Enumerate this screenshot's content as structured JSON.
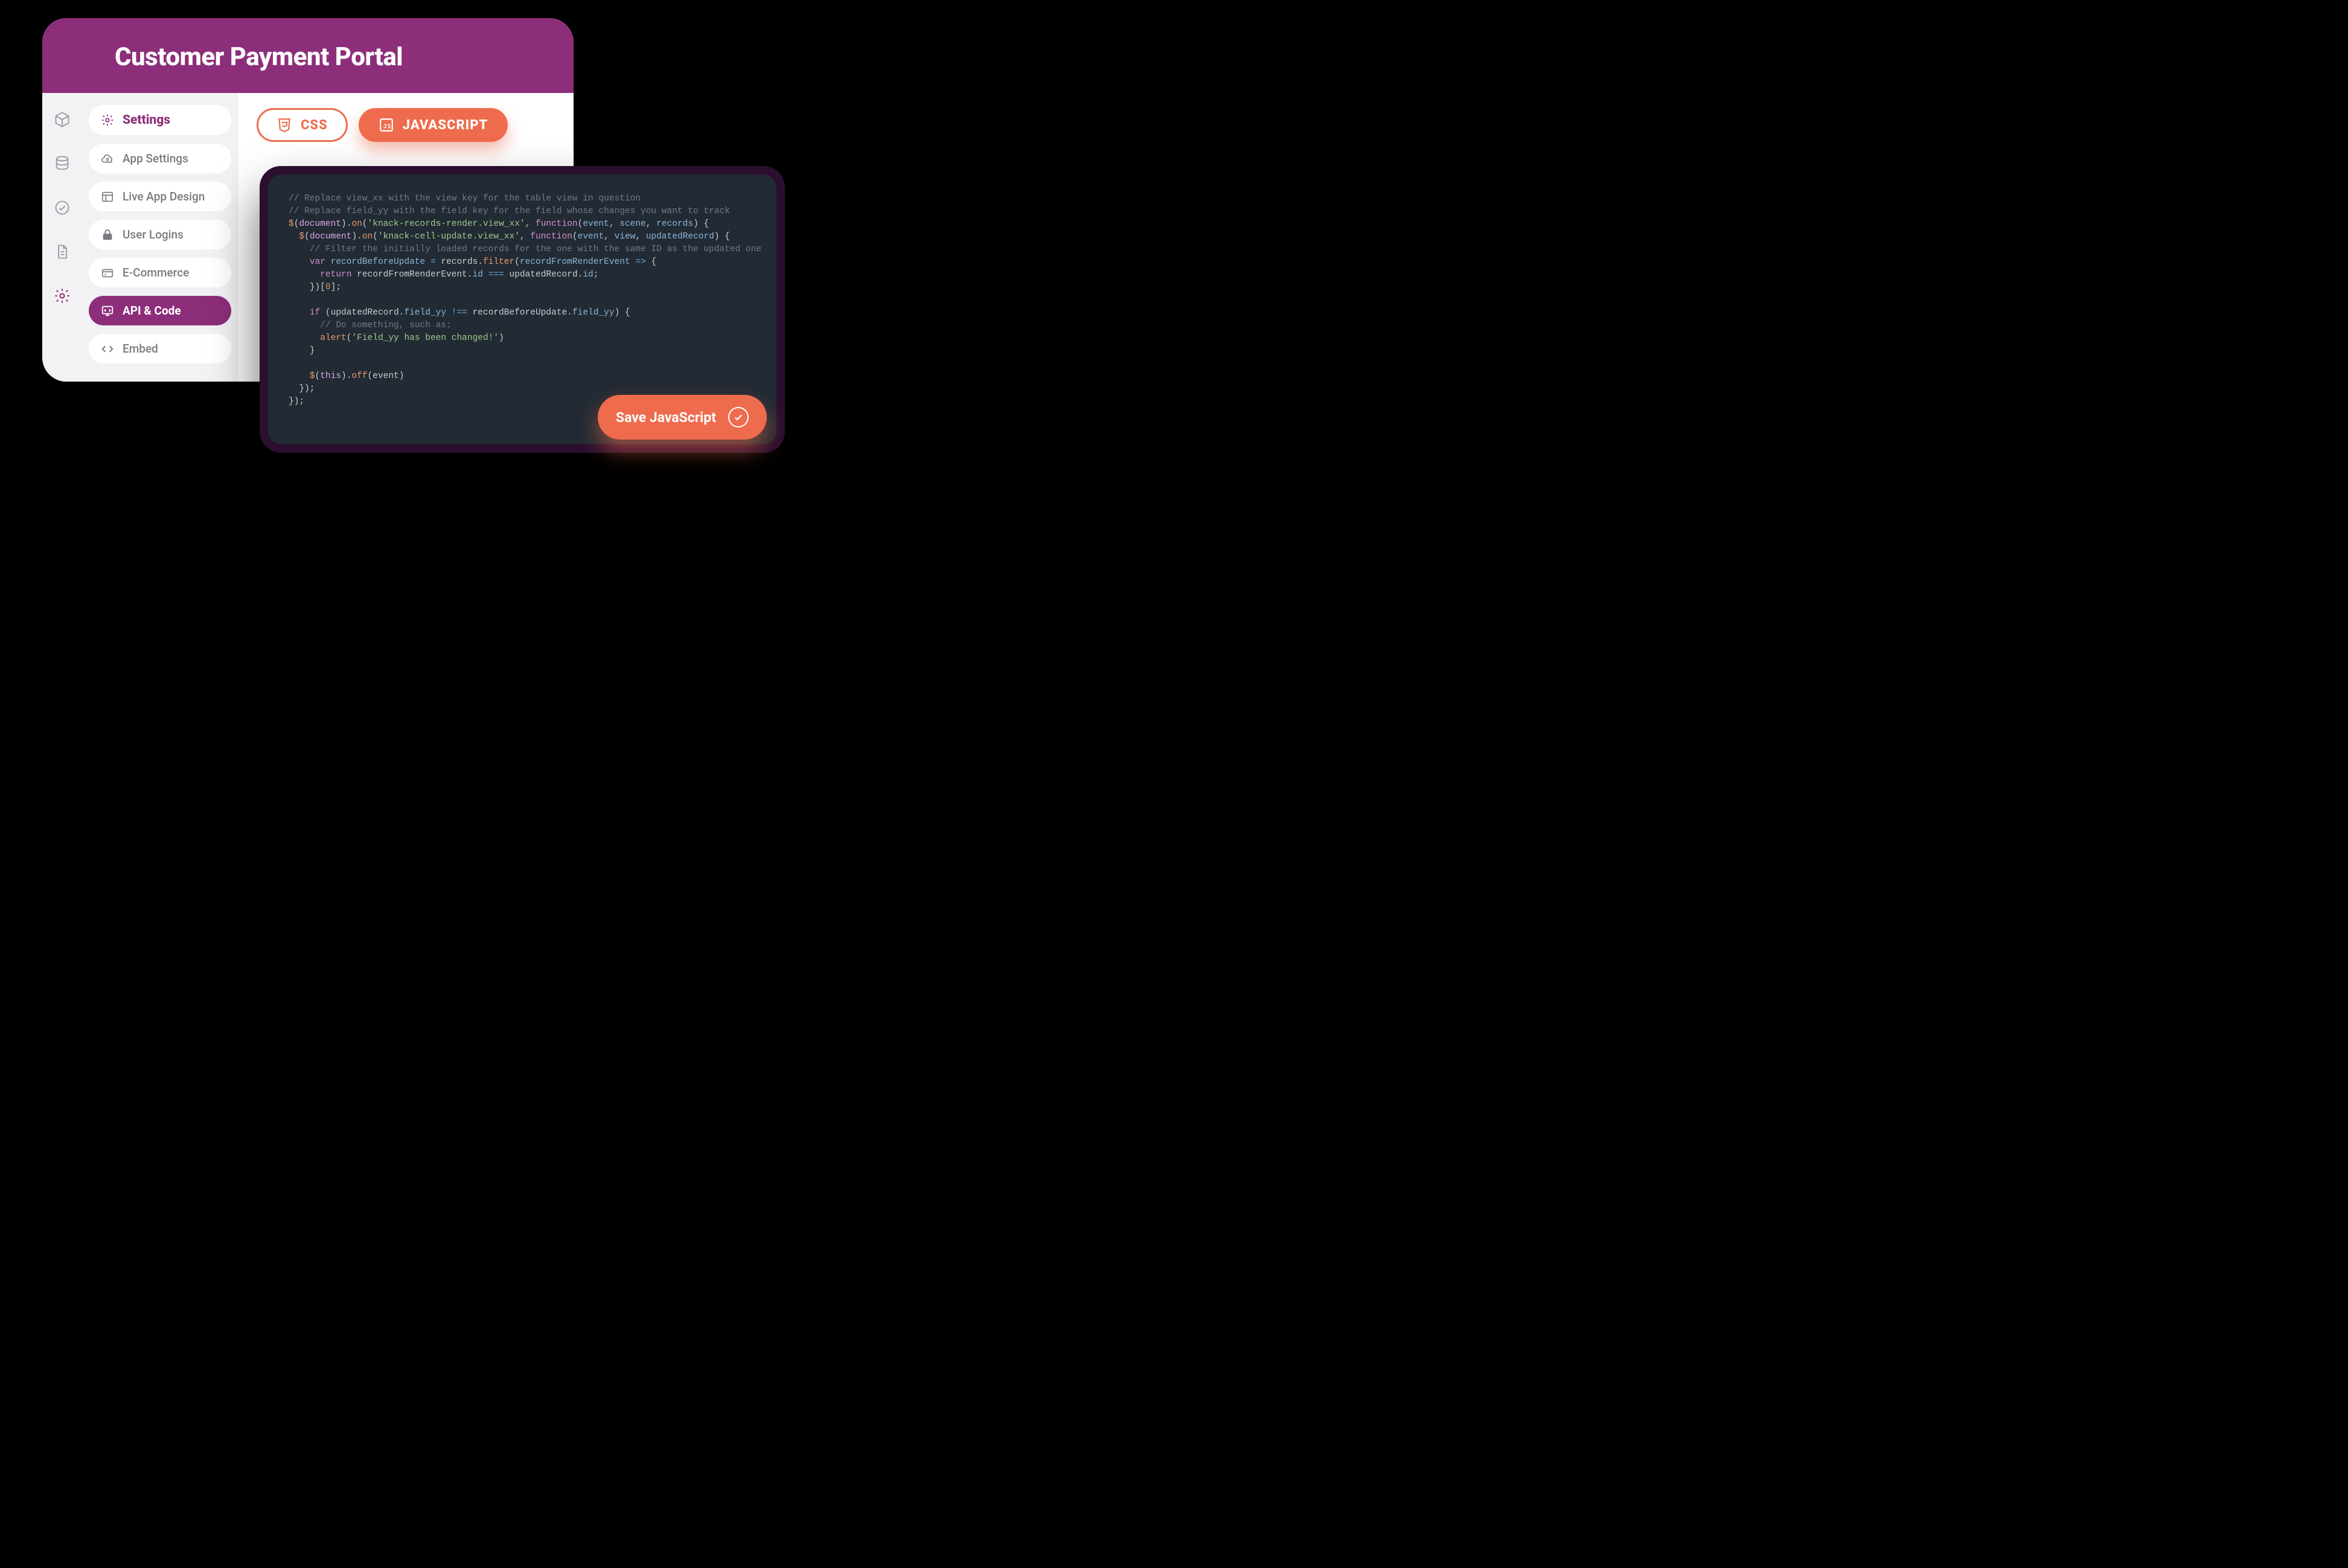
{
  "header": {
    "title": "Customer Payment Portal"
  },
  "settingsMenu": {
    "heading": "Settings",
    "items": {
      "appSettings": "App Settings",
      "liveAppDesign": "Live App Design",
      "userLogins": "User Logins",
      "ecommerce": "E-Commerce",
      "apiCode": "API & Code",
      "embed": "Embed"
    }
  },
  "tabs": {
    "css": "CSS",
    "js": "JAVASCRIPT"
  },
  "saveButton": {
    "label": "Save JavaScript"
  },
  "code": {
    "c1": "// Replace view_xx with the view key for the table view in question",
    "c2": "// Replace field_yy with the field key for the field whose changes you want to track",
    "s1": "'knack-records-render.view_xx'",
    "s2": "'knack-cell-update.view_xx'",
    "c3": "// Filter the initially loaded records for the one with the same ID as the updated one",
    "c4": "// Do something, such as:",
    "s3": "'Field_yy has been changed!'",
    "dollar": "$",
    "document": "document",
    "on": "on",
    "function": "function",
    "event": "event",
    "scene": "scene",
    "records": "records",
    "view": "view",
    "updatedRecord": "updatedRecord",
    "var": "var",
    "recordBeforeUpdate": "recordBeforeUpdate",
    "filter": "filter",
    "recordFromRenderEvent": "recordFromRenderEvent",
    "return": "return",
    "id": "id",
    "zero": "0",
    "if": "if",
    "field_yy": "field_yy",
    "alert": "alert",
    "this": "this",
    "off": "off"
  }
}
